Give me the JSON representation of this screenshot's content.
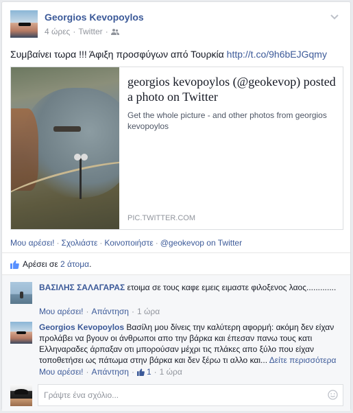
{
  "post": {
    "author": "Georgios Kevopoylos",
    "time": "4 ώρες",
    "source": "Twitter",
    "audience_icon": "friends-icon",
    "status_text": "Συμβαίνει τωρα !!! Άφιξη προσφύγων από Τουρκία ",
    "status_link": "http://t.co/9h6bEJGqmy"
  },
  "link_card": {
    "title": "georgios kevopoylos (@geokevop) posted a photo on Twitter",
    "description": "Get the whole picture - and other photos from georgios kevopoylos",
    "domain": "PIC.TWITTER.COM"
  },
  "actions": {
    "like": "Μου αρέσει!",
    "comment": "Σχολιάστε",
    "share": "Κοινοποιήστε",
    "twitter": "@geokevop on Twitter"
  },
  "likes": {
    "prefix": "Αρέσει σε ",
    "count": "2 άτομα",
    "suffix": "."
  },
  "comments": [
    {
      "author": "ΒΑΣΙΛΗΣ ΣΑΛΑΓΑΡΑΣ",
      "text": " ετοιμα σε τους καφε εμεις ειμαστε φιλοξενος λαος.............",
      "like": "Μου αρέσει!",
      "reply": "Απάντηση",
      "time": "1 ώρα"
    },
    {
      "author": "Georgios Kevopoylos",
      "text": " Βασίλη μου δίνεις την καλύτερη αφορμή: ακόμη δεν είχαν προλάβει να βγουν οι άνθρωποι απο την βάρκα και έπεσαν πανω τους κατι Ελληναραδες άρπαξαν οτι μπορούσαν μέχρι τις πλάκες απο ξύλο που είχαν τοποθετήσει ως πάτωμα στην βάρκα και δεν ξέρω τι αλλο και... ",
      "see_more": "Δείτε περισσότερα",
      "like": "Μου αρέσει!",
      "reply": "Απάντηση",
      "like_count": "1",
      "time": "1 ώρα"
    }
  ],
  "composer": {
    "placeholder": "Γράψτε ένα σχόλιο..."
  },
  "colors": {
    "link": "#3b5998",
    "muted": "#90949c",
    "comments_bg": "#f6f7f9"
  }
}
